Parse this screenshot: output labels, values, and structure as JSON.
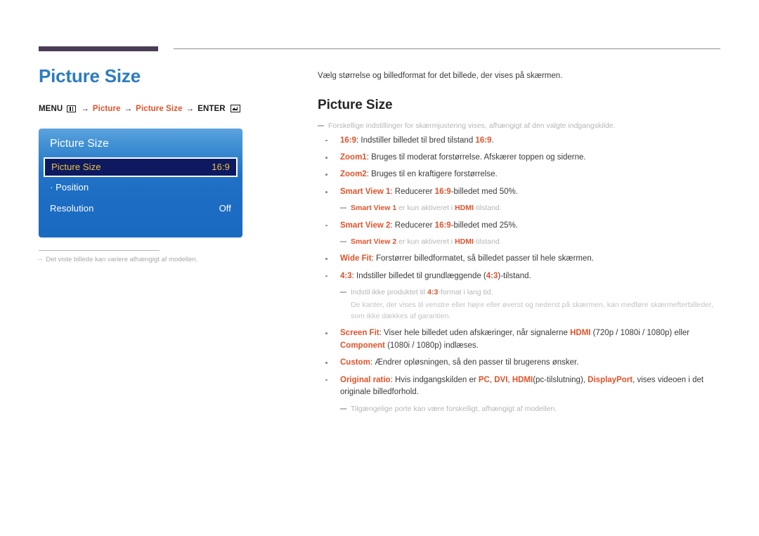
{
  "left": {
    "title": "Picture Size",
    "menu_path": {
      "menu_label": "MENU",
      "menu_icon": "menu-grid-icon",
      "arrow": "→",
      "step1": "Picture",
      "step2": "Picture Size",
      "enter_label": "ENTER",
      "enter_icon": "enter-key-icon"
    },
    "osd": {
      "title": "Picture Size",
      "rows": [
        {
          "label": "Picture Size",
          "value": "16:9",
          "selected": true,
          "sub": false
        },
        {
          "label": "· Position",
          "value": "",
          "selected": false,
          "sub": false
        },
        {
          "label": "Resolution",
          "value": "Off",
          "selected": false,
          "sub": false
        }
      ]
    },
    "footnote": {
      "dash": "–",
      "text": "Det viste billede kan variere afhængigt af modellen."
    }
  },
  "right": {
    "intro": "Vælg størrelse og billedformat for det billede, der vises på skærmen.",
    "title": "Picture Size",
    "top_note": "Forskellige indstillinger for skærmjustering vises, afhængigt af den valgte indgangskilde.",
    "items": [
      {
        "term": "16:9",
        "rest_a": ": Indstiller billedet til bred tilstand ",
        "hl": "16:9",
        "rest_b": "."
      },
      {
        "term": "Zoom1",
        "rest_a": ": Bruges til moderat forstørrelse. Afskærer toppen og siderne.",
        "hl": "",
        "rest_b": ""
      },
      {
        "term": "Zoom2",
        "rest_a": ": Bruges til en kraftigere forstørrelse.",
        "hl": "",
        "rest_b": ""
      },
      {
        "term": "Smart View 1",
        "rest_a": ": Reducerer ",
        "hl": "16:9",
        "rest_b": "-billedet med 50%."
      },
      {
        "term": "Smart View 2",
        "rest_a": ": Reducerer ",
        "hl": "16:9",
        "rest_b": "-billedet med 25%."
      },
      {
        "term": "Wide Fit",
        "rest_a": ": Forstørrer billedformatet, så billedet passer til hele skærmen.",
        "hl": "",
        "rest_b": ""
      },
      {
        "term": "4:3",
        "rest_a": ": Indstiller billedet til grundlæggende (",
        "hl": "4:3",
        "rest_b": ")-tilstand."
      }
    ],
    "smartview1_note": {
      "term": "Smart View 1",
      "mid": " er kun aktiveret i ",
      "hl": "HDMI",
      "end": "-tilstand."
    },
    "smartview2_note": {
      "term": "Smart View 2",
      "mid": " er kun aktiveret i ",
      "hl": "HDMI",
      "end": "-tilstand."
    },
    "fourthree_note": {
      "pre": "Indstil ikke produktet til ",
      "hl": "4:3",
      "post": "-format i lang tid."
    },
    "fourthree_note_cont": "De kanter, der vises til venstre eller højre eller øverst og nederst på skærmen, kan medføre skærmefterbilleder, som ikke dækkes af garantien.",
    "screenfit": {
      "term": "Screen Fit",
      "a": ": Viser hele billedet uden afskæringer, når signalerne ",
      "hdmi": "HDMI",
      "b": " (720p / 1080i / 1080p) eller ",
      "component": "Component",
      "c": " (1080i / 1080p) indlæses."
    },
    "custom": {
      "term": "Custom",
      "rest": ": Ændrer opløsningen, så den passer til brugerens ønsker."
    },
    "original_ratio": {
      "term": "Original ratio",
      "a": ": Hvis indgangskilden er ",
      "pc": "PC",
      "sep1": ", ",
      "dvi": "DVI",
      "sep2": ", ",
      "hdmi": "HDMI",
      "b": "(pc-tilslutning), ",
      "displayport": "DisplayPort",
      "c": ", vises videoen i det originale billedforhold."
    },
    "bottom_note": "Tilgængelige porte kan være forskelligt, afhængigt af modellen."
  },
  "colors": {
    "accent_blue": "#2c7cc0",
    "accent_orange": "#e0522a",
    "rule_dark": "#493d56",
    "osd_selected_bg": "#0d1a60",
    "osd_selected_text": "#f0c53f"
  }
}
